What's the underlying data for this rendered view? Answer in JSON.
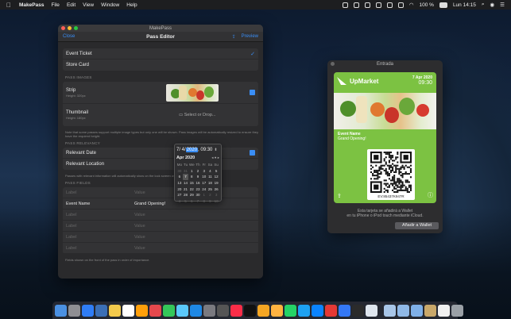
{
  "menubar": {
    "app_name": "MakePass",
    "menus": [
      "File",
      "Edit",
      "View",
      "Window",
      "Help"
    ],
    "battery": "100 %",
    "clock": "Lun 14:15"
  },
  "editor": {
    "window_title": "MakePass",
    "toolbar_title": "Pass Editor",
    "close_label": "Close",
    "preview_label": "Preview",
    "pass_types": [
      {
        "label": "Event Ticket",
        "checked": true
      },
      {
        "label": "Store Card",
        "checked": false
      }
    ],
    "pass_images_header": "PASS IMAGES",
    "strip": {
      "label": "Strip",
      "sub": "Height: 320px"
    },
    "thumbnail": {
      "label": "Thumbnail",
      "sub": "Height: 180px",
      "select_label": "Select or Drop..."
    },
    "images_hint": "Note that some passes support multiple image types but only one will be shown. Pass images will be automatically resized to ensure they have the required height.",
    "relevancy_header": "PASS RELEVANCY",
    "relevant_date_label": "Relevant Date",
    "relevant_location_label": "Relevant Location",
    "relevancy_hint": "Passes with relevant information will automatically show on the lock screen when it's relevant to the user.",
    "fields_header": "PASS FIELDS",
    "fields": [
      {
        "label": "Label",
        "value": "Value",
        "filled": false
      },
      {
        "label": "Event Name",
        "value": "Grand Opening!",
        "filled": true
      },
      {
        "label": "Label",
        "value": "Value",
        "filled": false
      },
      {
        "label": "Label",
        "value": "Value",
        "filled": false
      },
      {
        "label": "Label",
        "value": "Value",
        "filled": false
      },
      {
        "label": "Label",
        "value": "Value",
        "filled": false
      }
    ],
    "fields_hint": "Fields shown on the front of the pass in order of importance."
  },
  "datepicker": {
    "date_prefix": "7/ 4/",
    "date_year": "2020",
    "date_time": ", 09:30",
    "month_label": "Apr 2020",
    "nav": "◂ ● ▸",
    "weekdays": [
      "Mo",
      "Tu",
      "We",
      "Th",
      "Fr",
      "Sa",
      "Su"
    ],
    "days": [
      "30",
      "31",
      "1",
      "2",
      "3",
      "4",
      "5",
      "6",
      "7",
      "8",
      "9",
      "10",
      "11",
      "12",
      "13",
      "14",
      "15",
      "16",
      "17",
      "18",
      "19",
      "20",
      "21",
      "22",
      "23",
      "24",
      "25",
      "26",
      "27",
      "28",
      "29",
      "30",
      "1",
      "2",
      "3",
      "4",
      "5",
      "6",
      "7",
      "8",
      "9",
      "10"
    ],
    "dim_indices": [
      0,
      1,
      32,
      33,
      34,
      35,
      36,
      37,
      38,
      39,
      40,
      41
    ],
    "selected_index": 8
  },
  "preview": {
    "window_title": "Entrada",
    "brand": "UpMarket",
    "date": "7 Apr 2020",
    "time": "09:30",
    "field_label": "Event Name",
    "field_value": "Grand Opening!",
    "barcode_text": "EV:85437K947R",
    "note_line1": "Esta tarjeta se añadirá a Wallet",
    "note_line2": "en tu iPhone o iPod touch mediante iCloud.",
    "add_button": "Añadir a Wallet",
    "card_color": "#7cc242"
  },
  "dock": {
    "icons": [
      "finder-icon",
      "launchpad-icon",
      "app-store-icon",
      "preview-icon",
      "notes-icon",
      "calendar-icon",
      "reminders-icon",
      "news-icon",
      "stocks-icon",
      "maps-icon",
      "safari-icon",
      "system-prefs-icon",
      "screenshot-icon",
      "music-icon",
      "tv-icon",
      "photos-icon",
      "home-icon",
      "whatsapp-icon",
      "twitter-icon",
      "maps-pin-icon",
      "makepass-icon",
      "xcode-icon",
      "terminal-icon",
      "activity-icon",
      "folder-home-icon",
      "folder-docs-icon",
      "folder-downloads-icon",
      "archive-icon",
      "file-icon",
      "trash-icon"
    ]
  }
}
